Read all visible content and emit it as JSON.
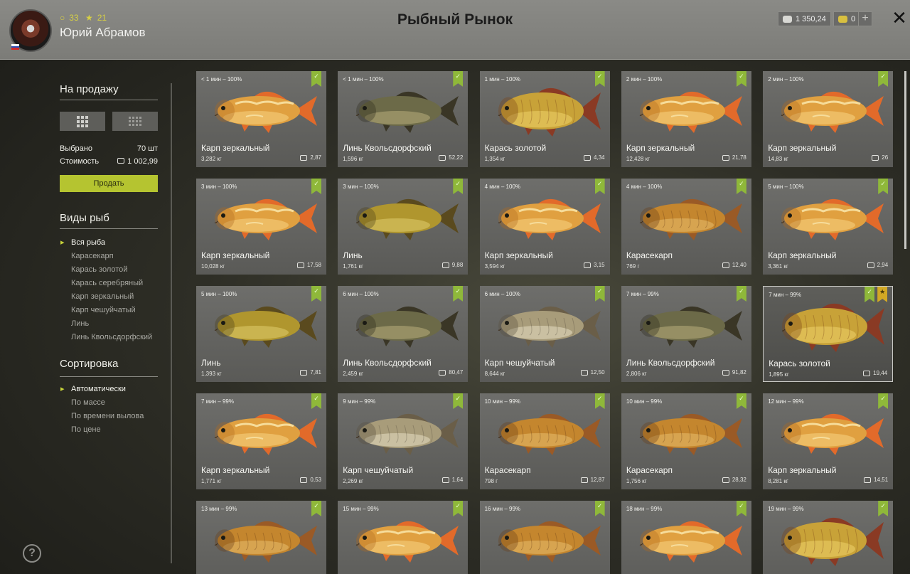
{
  "header": {
    "level": "33",
    "rating": "21",
    "player_name": "Юрий Абрамов",
    "title": "Рыбный Рынок",
    "silver": "1 350,24",
    "gold": "0",
    "plus": "+",
    "close": "✕"
  },
  "colors": {
    "accent": "#b5c430",
    "ribbon_green": "#8fb83a",
    "ribbon_gold": "#d2a824"
  },
  "sidebar": {
    "sale_title": "На продажу",
    "selected_label": "Выбрано",
    "selected_value": "70 шт",
    "cost_label": "Стоимость",
    "cost_value": "1 002,99",
    "sell_button": "Продать",
    "species_title": "Виды рыб",
    "species": [
      "Вся рыба",
      "Карасекарп",
      "Карась золотой",
      "Карась серебряный",
      "Карп зеркальный",
      "Карп чешуйчатый",
      "Линь",
      "Линь Квольсдорфский"
    ],
    "sort_title": "Сортировка",
    "sorts": [
      "Автоматически",
      "По массе",
      "По времени вылова",
      "По цене"
    ],
    "help": "?"
  },
  "cards": [
    {
      "time": "< 1 мин – 100%",
      "name": "Карп зеркальный",
      "weight": "3,282 кг",
      "price": "2,87",
      "fish": "mirror",
      "star": false
    },
    {
      "time": "< 1 мин – 100%",
      "name": "Линь Квольсдорфский",
      "weight": "1,596 кг",
      "price": "52,22",
      "fish": "tench_dark",
      "star": false
    },
    {
      "time": "1 мин – 100%",
      "name": "Карась золотой",
      "weight": "1,354 кг",
      "price": "4,34",
      "fish": "goldcrucian",
      "star": false
    },
    {
      "time": "2 мин – 100%",
      "name": "Карп зеркальный",
      "weight": "12,428 кг",
      "price": "21,78",
      "fish": "mirror",
      "star": false
    },
    {
      "time": "2 мин – 100%",
      "name": "Карп зеркальный",
      "weight": "14,83 кг",
      "price": "26",
      "fish": "mirror",
      "star": false
    },
    {
      "time": "3 мин – 100%",
      "name": "Карп зеркальный",
      "weight": "10,028 кг",
      "price": "17,58",
      "fish": "mirror",
      "star": false
    },
    {
      "time": "3 мин – 100%",
      "name": "Линь",
      "weight": "1,761 кг",
      "price": "9,88",
      "fish": "tench",
      "star": false
    },
    {
      "time": "4 мин – 100%",
      "name": "Карп зеркальный",
      "weight": "3,594 кг",
      "price": "3,15",
      "fish": "mirror",
      "star": false
    },
    {
      "time": "4 мин – 100%",
      "name": "Карасекарп",
      "weight": "769 г",
      "price": "12,40",
      "fish": "hybrid",
      "star": false
    },
    {
      "time": "5 мин – 100%",
      "name": "Карп зеркальный",
      "weight": "3,361 кг",
      "price": "2,94",
      "fish": "mirror",
      "star": false
    },
    {
      "time": "5 мин – 100%",
      "name": "Линь",
      "weight": "1,393 кг",
      "price": "7,81",
      "fish": "tench",
      "star": false
    },
    {
      "time": "6 мин – 100%",
      "name": "Линь Квольсдорфский",
      "weight": "2,459 кг",
      "price": "80,47",
      "fish": "tench_dark",
      "star": false
    },
    {
      "time": "6 мин – 100%",
      "name": "Карп чешуйчатый",
      "weight": "8,644 кг",
      "price": "12,50",
      "fish": "common",
      "star": false
    },
    {
      "time": "7 мин – 99%",
      "name": "Линь Квольсдорфский",
      "weight": "2,806 кг",
      "price": "91,82",
      "fish": "tench_dark",
      "star": false
    },
    {
      "time": "7 мин – 99%",
      "name": "Карась золотой",
      "weight": "1,895 кг",
      "price": "19,44",
      "fish": "goldcrucian",
      "star": true
    },
    {
      "time": "7 мин – 99%",
      "name": "Карп зеркальный",
      "weight": "1,771 кг",
      "price": "0,53",
      "fish": "mirror",
      "star": false
    },
    {
      "time": "9 мин – 99%",
      "name": "Карп чешуйчатый",
      "weight": "2,269 кг",
      "price": "1,64",
      "fish": "common",
      "star": false
    },
    {
      "time": "10 мин – 99%",
      "name": "Карасекарп",
      "weight": "798 г",
      "price": "12,87",
      "fish": "hybrid",
      "star": false
    },
    {
      "time": "10 мин – 99%",
      "name": "Карасекарп",
      "weight": "1,756 кг",
      "price": "28,32",
      "fish": "hybrid",
      "star": false
    },
    {
      "time": "12 мин – 99%",
      "name": "Карп зеркальный",
      "weight": "8,281 кг",
      "price": "14,51",
      "fish": "mirror",
      "star": false
    },
    {
      "time": "13 мин – 99%",
      "name": "",
      "weight": "",
      "price": "",
      "fish": "hybrid",
      "star": false
    },
    {
      "time": "15 мин – 99%",
      "name": "",
      "weight": "",
      "price": "",
      "fish": "mirror",
      "star": false
    },
    {
      "time": "16 мин – 99%",
      "name": "",
      "weight": "",
      "price": "",
      "fish": "hybrid",
      "star": false
    },
    {
      "time": "18 мин – 99%",
      "name": "",
      "weight": "",
      "price": "",
      "fish": "mirror",
      "star": false
    },
    {
      "time": "19 мин – 99%",
      "name": "",
      "weight": "",
      "price": "",
      "fish": "goldcrucian",
      "star": false
    }
  ]
}
